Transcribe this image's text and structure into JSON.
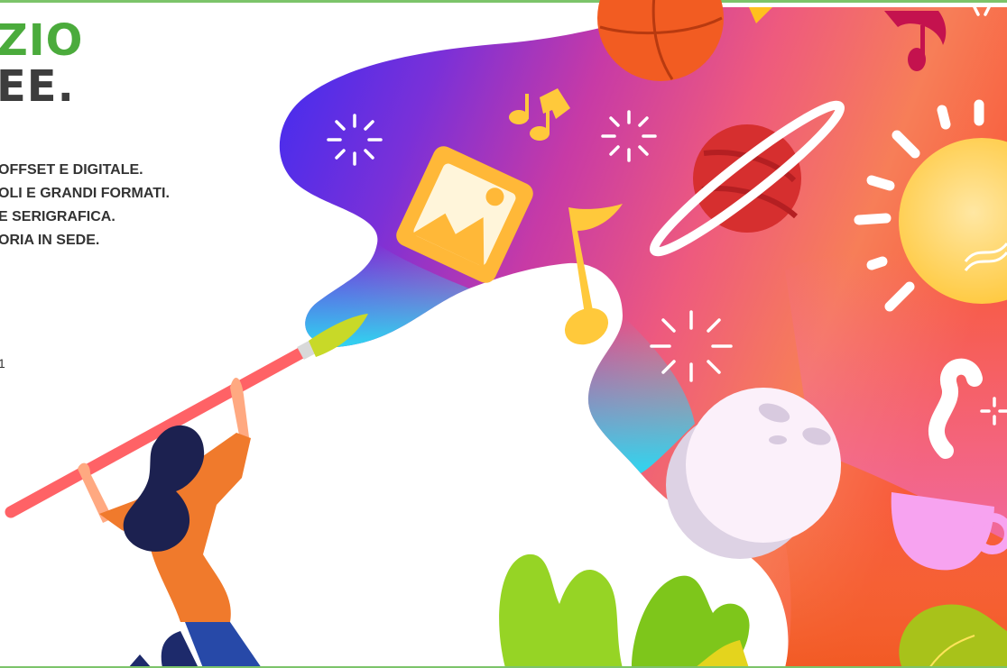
{
  "hero": {
    "headline_line1": "ZIO",
    "headline_line2": "EE.",
    "services": [
      "OFFSET E DIGITALE.",
      "OLI E GRANDI FORMATI.",
      "E SERIGRAFICA.",
      "ORIA IN SEDE."
    ],
    "side_digit": "1"
  },
  "colors": {
    "accent_green": "#4bab3c",
    "heading_dark": "#3d3d3d",
    "body_text": "#333333",
    "divider_green": "#7cc46a"
  },
  "icons": [
    "paint-splash-illustration",
    "paintbrush-icon",
    "woman-illustration",
    "basketball-icon",
    "music-note-icon",
    "picture-frame-icon",
    "planet-icon",
    "lightbulb-icon",
    "moon-icon",
    "coffee-cup-icon",
    "sparkle-icon",
    "leaf-icon"
  ]
}
